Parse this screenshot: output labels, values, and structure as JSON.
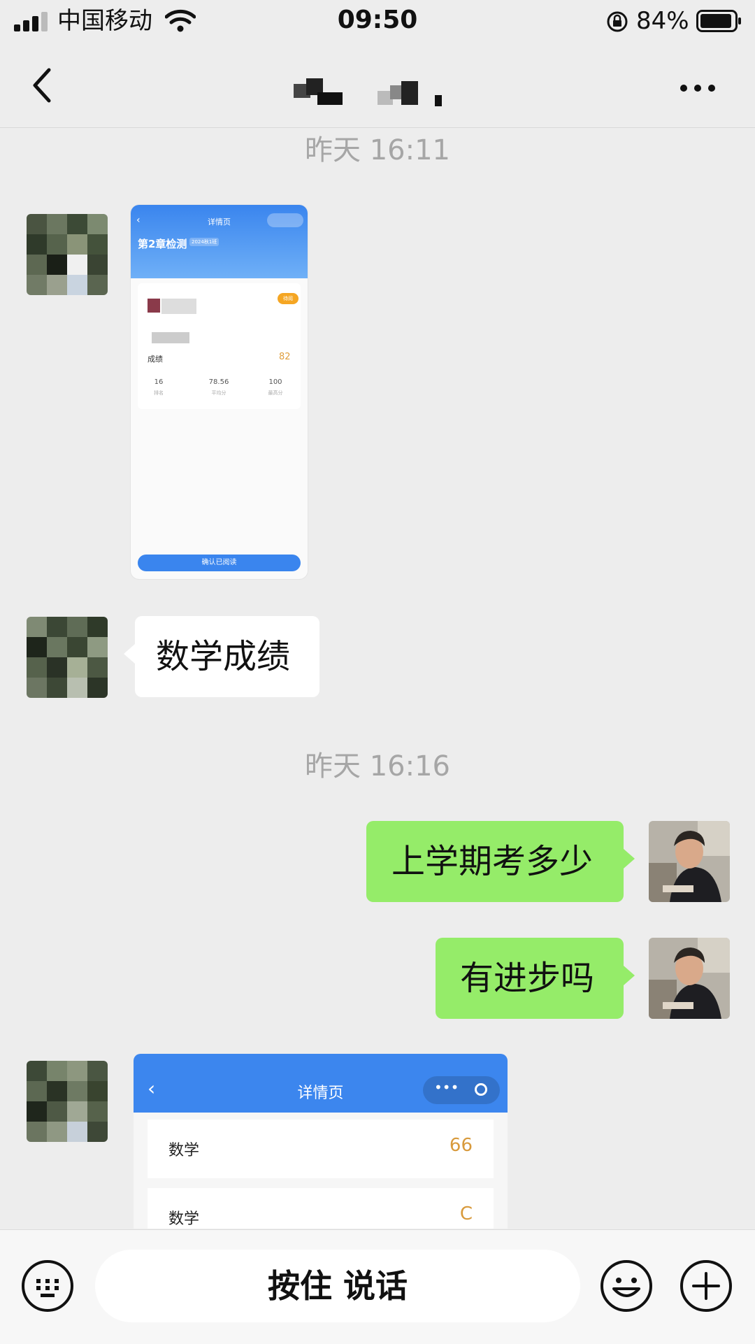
{
  "status_bar": {
    "carrier": "中国移动",
    "time": "09:50",
    "battery": "84%"
  },
  "chat": {
    "timestamps": [
      "昨天 16:11",
      "昨天 16:16"
    ],
    "messages": [
      {
        "side": "left",
        "type": "image"
      },
      {
        "side": "left",
        "type": "text",
        "text": "数学成绩"
      },
      {
        "side": "right",
        "type": "text",
        "text": "上学期考多少"
      },
      {
        "side": "right",
        "type": "text",
        "text": "有进步吗"
      },
      {
        "side": "left",
        "type": "image"
      }
    ],
    "image1": {
      "header_title": "详情页",
      "heading": "第2章检测",
      "tag": "2024秋1班",
      "score_label": "成绩",
      "score_value": "82",
      "stats": [
        {
          "value": "16",
          "label": "排名"
        },
        {
          "value": "78.56",
          "label": "平均分"
        },
        {
          "value": "100",
          "label": "最高分"
        }
      ],
      "badge": "待阅",
      "button": "确认已阅读"
    },
    "image2": {
      "header_title": "详情页",
      "rows": [
        {
          "label": "数学",
          "value": "66"
        },
        {
          "label": "数学",
          "value": "C"
        }
      ]
    }
  },
  "input_bar": {
    "voice_label": "按住 说话"
  },
  "colors": {
    "my_bubble": "#95ec69",
    "their_bubble": "#ffffff",
    "background": "#ededed",
    "app_blue": "#3c86ee"
  }
}
